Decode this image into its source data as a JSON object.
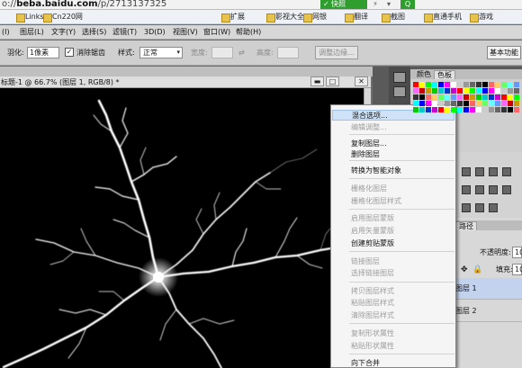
{
  "browser": {
    "url_prefix": "o://",
    "url_host": "beba.baidu.com",
    "url_path": "/p/2713137325",
    "share_button": "快照",
    "search_button": "Q"
  },
  "bookmarks": [
    {
      "label": "Links"
    },
    {
      "label": "Cn220网"
    },
    {
      "label": "扩展"
    },
    {
      "label": "影视大全"
    },
    {
      "label": "网银"
    },
    {
      "label": "翻译"
    },
    {
      "label": "截图"
    },
    {
      "label": "直通手机"
    },
    {
      "label": "游戏"
    }
  ],
  "menubar": [
    {
      "label": "(I)"
    },
    {
      "label": "图层(L)"
    },
    {
      "label": "文字(Y)"
    },
    {
      "label": "选择(S)"
    },
    {
      "label": "滤镜(T)"
    },
    {
      "label": "3D(D)"
    },
    {
      "label": "视图(V)"
    },
    {
      "label": "窗口(W)"
    },
    {
      "label": "帮助(H)"
    }
  ],
  "options": {
    "feather_label": "羽化:",
    "feather_value": "1像素",
    "antialias_label": "消除锯齿",
    "antialias_checked": "✓",
    "style_label": "样式:",
    "style_value": "正常",
    "width_label": "宽度:",
    "height_label": "高度:",
    "refine_edge": "调整边缘...",
    "workspace": "基本功能"
  },
  "document": {
    "title": "标题-1 @ 66.7% (图层 1, RGB/8) *",
    "minimize": "▬",
    "restore": "□",
    "close": "✕"
  },
  "swatches": {
    "tab1": "颜色",
    "tab2": "色板",
    "colors": [
      "#ff0000",
      "#ffff00",
      "#00ff00",
      "#00ffff",
      "#0000ff",
      "#ff00ff",
      "#ffffff",
      "#cccccc",
      "#999999",
      "#666666",
      "#333333",
      "#000000",
      "#ff6666",
      "#ffcc66",
      "#66ff66",
      "#66ffff",
      "#6699ff",
      "#ff66ff",
      "#cc0000",
      "#cc9900",
      "#00cc00",
      "#00cccc",
      "#0033cc",
      "#cc00cc"
    ]
  },
  "layers": {
    "tab_label": "路径",
    "opacity_label": "不透明度:",
    "opacity_value": "10",
    "fill_label": "填充:",
    "fill_value": "10",
    "rows": [
      {
        "name": "图层 1"
      },
      {
        "name": "图层 2"
      }
    ]
  },
  "context_menu": [
    {
      "label": "混合选项...",
      "state": "highlight"
    },
    {
      "label": "编辑调整...",
      "state": "disabled"
    },
    {
      "label": "复制图层...",
      "state": "normal"
    },
    {
      "label": "删除图层",
      "state": "normal"
    },
    {
      "label": "转换为智能对象",
      "state": "normal"
    },
    {
      "label": "栅格化图层",
      "state": "disabled"
    },
    {
      "label": "栅格化图层样式",
      "state": "disabled"
    },
    {
      "label": "启用图层蒙版",
      "state": "disabled"
    },
    {
      "label": "启用矢量蒙版",
      "state": "disabled"
    },
    {
      "label": "创建剪贴蒙版",
      "state": "normal"
    },
    {
      "label": "链接图层",
      "state": "disabled"
    },
    {
      "label": "选择链接图层",
      "state": "disabled"
    },
    {
      "label": "拷贝图层样式",
      "state": "disabled"
    },
    {
      "label": "粘贴图层样式",
      "state": "disabled"
    },
    {
      "label": "清除图层样式",
      "state": "disabled"
    },
    {
      "label": "复制形状属性",
      "state": "disabled"
    },
    {
      "label": "粘贴形状属性",
      "state": "disabled"
    },
    {
      "label": "向下合并",
      "state": "normal"
    }
  ]
}
